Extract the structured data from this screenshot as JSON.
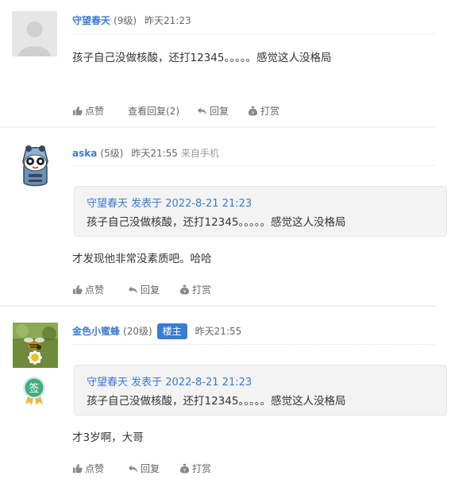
{
  "posts": [
    {
      "username": "守望春天",
      "level": "(9级)",
      "time": "昨天21:23",
      "content": "孩子自己没做核酸，还打12345。。。。。感觉这人没格局",
      "actions": {
        "like": "点赞",
        "view_replies": "查看回复(2)",
        "reply": "回复",
        "tip": "打赏"
      }
    },
    {
      "username": "aska",
      "level": "(5级)",
      "time": "昨天21:55",
      "source": "来自手机",
      "quote": {
        "author_line": "守望春天 发表于 2022-8-21 21:23",
        "text": "孩子自己没做核酸，还打12345。。。。。感觉这人没格局"
      },
      "content": "才发现他非常没素质吧。哈哈",
      "actions": {
        "like": "点赞",
        "reply": "回复",
        "tip": "打赏"
      }
    },
    {
      "username": "金色小蜜蜂",
      "level": "(20级)",
      "badge": "楼主",
      "time": "昨天21:55",
      "medal": "签",
      "quote": {
        "author_line": "守望春天 发表于 2022-8-21 21:23",
        "text": "孩子自己没做核酸，还打12345。。。。。感觉这人没格局"
      },
      "content": "才3岁啊，大哥",
      "actions": {
        "like": "点赞",
        "reply": "回复",
        "tip": "打赏"
      }
    }
  ],
  "colors": {
    "link": "#3a7bd5",
    "badge": "#3a7bd5",
    "medal": "#3fae7c"
  },
  "icons": [
    "default-avatar-icon",
    "thumb-up-icon",
    "reply-arrow-icon",
    "money-bag-icon",
    "sign-medal-icon"
  ]
}
